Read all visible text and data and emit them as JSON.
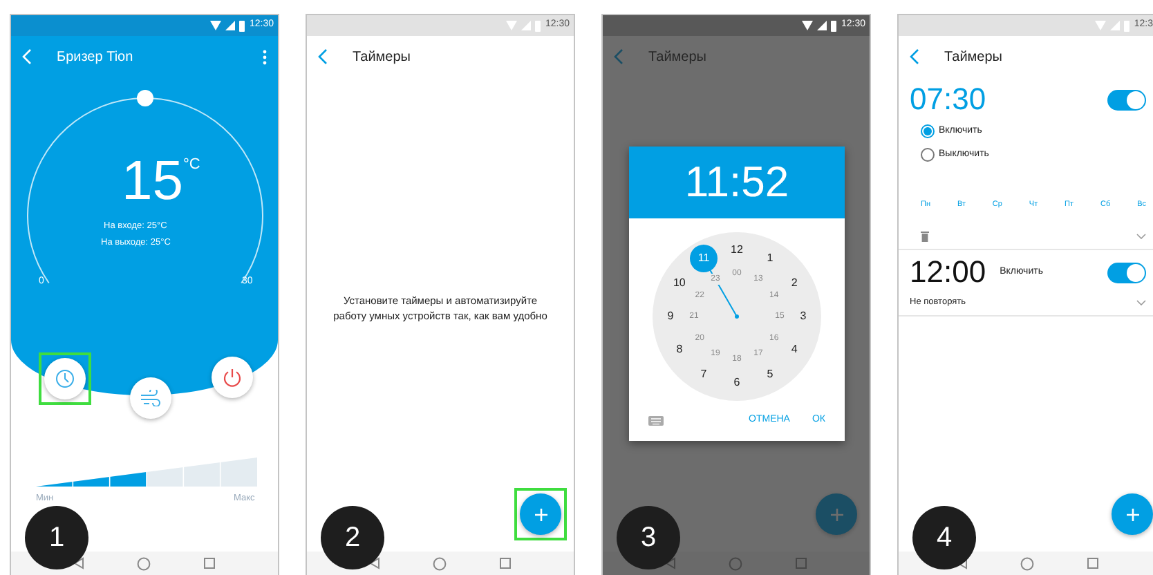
{
  "screens": [
    {
      "kind": "device",
      "step": "1",
      "status_time": "12:30",
      "title": "Бризер Tion",
      "temperature": "15",
      "unit": "°C",
      "dial": {
        "level": 0.5
      },
      "inlet": "На входе: 25°С",
      "outlet": "На выходе: 25°С",
      "scale_min": "0",
      "scale_max": "30",
      "actions": [
        {
          "kind": "timer",
          "highlighted": true
        },
        {
          "kind": "fan",
          "highlighted": false
        },
        {
          "kind": "power",
          "highlighted": false
        }
      ],
      "speed": {
        "level": 0.5,
        "min_label": "Мин",
        "max_label": "Макс"
      }
    },
    {
      "kind": "empty_list",
      "step": "2",
      "status_time": "12:30",
      "title": "Таймеры",
      "message": "Установите таймеры и автоматизируйте работу умных устройств так, как вам удобно",
      "add_button": {
        "highlighted": true
      }
    },
    {
      "kind": "time_picker",
      "step": "3",
      "status_time": "12:30",
      "title": "Таймеры",
      "add_button": {
        "highlighted": false
      },
      "dialog": {
        "time": "11:52",
        "outer_hours": [
          {
            "label": "12",
            "selected": false
          },
          {
            "label": "1",
            "selected": false
          },
          {
            "label": "2",
            "selected": false
          },
          {
            "label": "3",
            "selected": false
          },
          {
            "label": "4",
            "selected": false
          },
          {
            "label": "5",
            "selected": false
          },
          {
            "label": "6",
            "selected": false
          },
          {
            "label": "7",
            "selected": false
          },
          {
            "label": "8",
            "selected": false
          },
          {
            "label": "9",
            "selected": false
          },
          {
            "label": "10",
            "selected": false
          },
          {
            "label": "11",
            "selected": true
          }
        ],
        "inner_hours": [
          {
            "label": "00",
            "selected": false
          },
          {
            "label": "13",
            "selected": false
          },
          {
            "label": "14",
            "selected": false
          },
          {
            "label": "15",
            "selected": false
          },
          {
            "label": "16",
            "selected": false
          },
          {
            "label": "17",
            "selected": false
          },
          {
            "label": "18",
            "selected": false
          },
          {
            "label": "19",
            "selected": false
          },
          {
            "label": "20",
            "selected": false
          },
          {
            "label": "21",
            "selected": false
          },
          {
            "label": "22",
            "selected": false
          },
          {
            "label": "23",
            "selected": false
          }
        ],
        "cancel": "ОТМЕНА",
        "ok": "ОК"
      }
    },
    {
      "kind": "timer_list",
      "step": "4",
      "status_time": "12:3",
      "title": "Таймеры",
      "add_button": {
        "highlighted": false
      },
      "timers": [
        {
          "time": "07:30",
          "on": true,
          "expanded": true,
          "options": [
            {
              "label": "Включить",
              "selected": true
            },
            {
              "label": "Выключить",
              "selected": false
            }
          ],
          "days": [
            "Пн",
            "Вт",
            "Ср",
            "Чт",
            "Пт",
            "Сб",
            "Вс"
          ]
        },
        {
          "time": "12:00",
          "on": true,
          "expanded": false,
          "action": "Включить",
          "repeat": "Не повторять"
        }
      ]
    }
  ]
}
